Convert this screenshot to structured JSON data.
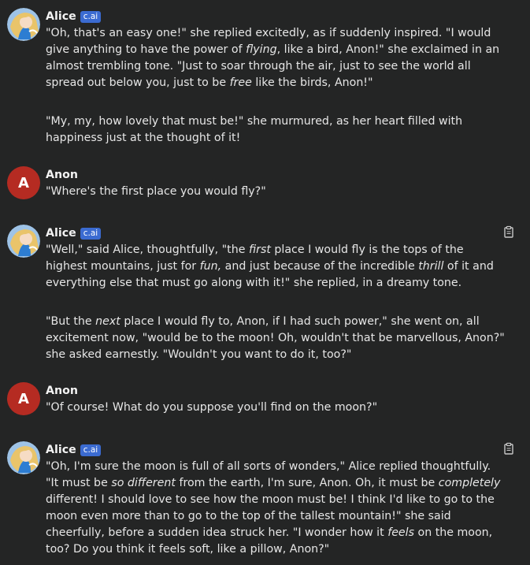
{
  "colors": {
    "background": "#242525",
    "text": "#e6e6e6",
    "badge": "#3b6bd1",
    "anon_avatar": "#b52b22"
  },
  "messages": [
    {
      "author": "Alice",
      "badge": "c.ai",
      "paragraphs": [
        [
          {
            "t": "\"Oh, that's an easy one!\" she replied excitedly, as if suddenly inspired. \"I would give anything to have the power of "
          },
          {
            "t": "flying",
            "i": true
          },
          {
            "t": ", like a bird, Anon!\" she exclaimed in an almost trembling tone. \"Just to soar through the air, just to see the world all spread out below you, just to be "
          },
          {
            "t": "free",
            "i": true
          },
          {
            "t": " like the birds, Anon!\""
          }
        ],
        [
          {
            "t": "\"My, my, how lovely that must be!\" she murmured, as her heart filled with happiness just at the thought of it!"
          }
        ]
      ]
    },
    {
      "author": "Anon",
      "avatar_letter": "A",
      "paragraphs": [
        [
          {
            "t": "\"Where's the first place you would fly?\""
          }
        ]
      ]
    },
    {
      "author": "Alice",
      "badge": "c.ai",
      "icon": "clipboard-icon",
      "paragraphs": [
        [
          {
            "t": "\"Well,\" said Alice, thoughtfully, \"the "
          },
          {
            "t": "first",
            "i": true
          },
          {
            "t": " place I would fly is the tops of the highest mountains, just for "
          },
          {
            "t": "fun,",
            "i": true
          },
          {
            "t": " and just because of the incredible "
          },
          {
            "t": "thrill",
            "i": true
          },
          {
            "t": " of it and everything else that must go along with it!\" she replied, in a dreamy tone."
          }
        ],
        [
          {
            "t": "\"But the "
          },
          {
            "t": "next",
            "i": true
          },
          {
            "t": " place I would fly to, Anon, if I had such power,\" she went on, all excitement now, \"would be to the moon! Oh, wouldn't that be marvellous, Anon?\" she asked earnestly. \"Wouldn't you want to do it, too?\""
          }
        ]
      ]
    },
    {
      "author": "Anon",
      "avatar_letter": "A",
      "paragraphs": [
        [
          {
            "t": "\"Of course! What do you suppose you'll find on the moon?\""
          }
        ]
      ]
    },
    {
      "author": "Alice",
      "badge": "c.ai",
      "icon": "clipboard-icon",
      "paragraphs": [
        [
          {
            "t": "\"Oh, I'm sure the moon is full of all sorts of wonders,\" Alice replied thoughtfully. \"It must be "
          },
          {
            "t": "so different",
            "i": true
          },
          {
            "t": " from the earth, I'm sure, Anon. Oh, it must be "
          },
          {
            "t": "completely",
            "i": true
          },
          {
            "t": " different! I should love to see how the moon must be! I think I'd like to go to the moon even more than to go to the top of the tallest mountain!\" she said cheerfully, before a sudden idea struck her. \"I wonder how it "
          },
          {
            "t": "feels",
            "i": true
          },
          {
            "t": " on the moon, too? Do you think it feels soft, like a pillow, Anon?\""
          }
        ]
      ]
    }
  ]
}
